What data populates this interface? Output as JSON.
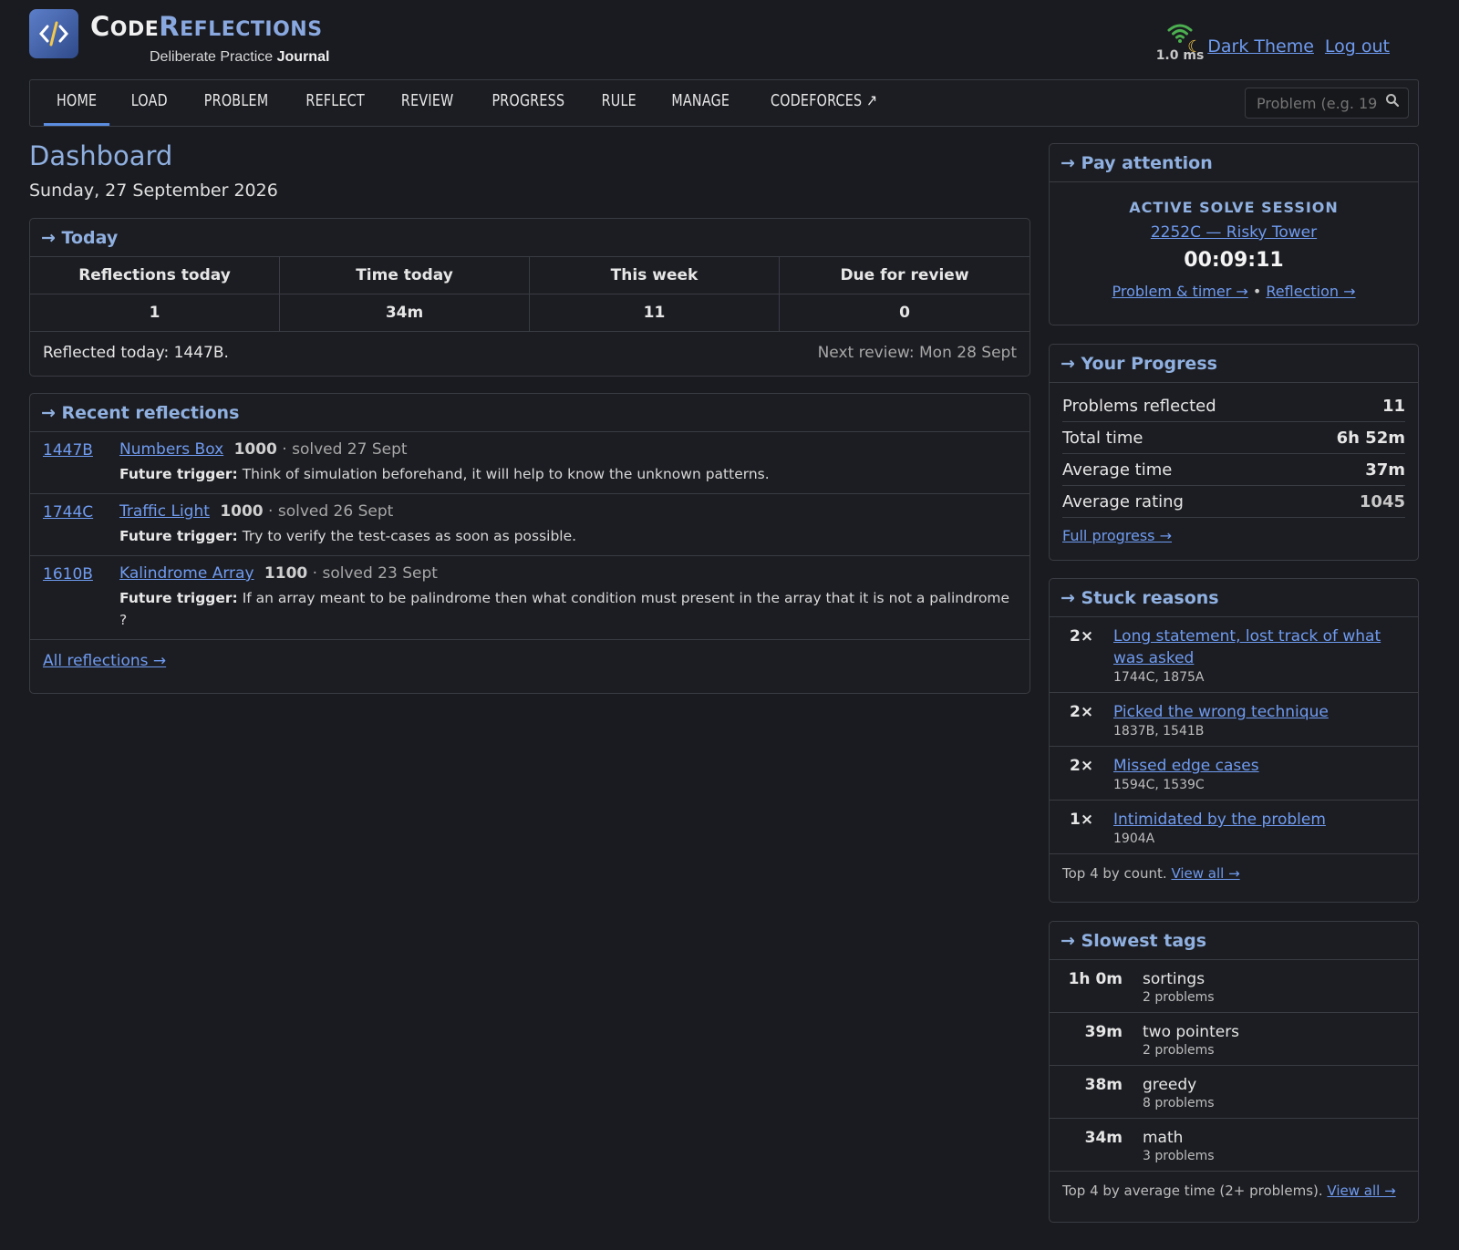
{
  "header": {
    "brand_main_1": "C",
    "brand_small_1": "ODE",
    "brand_main_2": "R",
    "brand_small_2": "EFLECTIONS",
    "tagline_prefix": "Deliberate Practice",
    "tagline_bold": "Journal",
    "latency": "1.0 ms",
    "theme_label": "Dark Theme",
    "logout_label": "Log out"
  },
  "nav": {
    "items": [
      "HOME",
      "LOAD",
      "PROBLEM",
      "REFLECT",
      "REVIEW",
      "PROGRESS",
      "RULE",
      "MANAGE",
      "CODEFORCES ↗"
    ],
    "active": "HOME",
    "search_placeholder": "Problem (e.g. 19"
  },
  "page": {
    "title": "Dashboard",
    "date": "Sunday, 27 September 2026"
  },
  "today": {
    "heading": "→ Today",
    "stats": [
      {
        "label": "Reflections today",
        "value": "1"
      },
      {
        "label": "Time today",
        "value": "34m"
      },
      {
        "label": "This week",
        "value": "11"
      },
      {
        "label": "Due for review",
        "value": "0"
      }
    ],
    "reflected": "Reflected today: 1447B.",
    "next_review": "Next review: Mon 28 Sept"
  },
  "recent": {
    "heading": "→ Recent reflections",
    "trigger_label": "Future trigger:",
    "items": [
      {
        "id": "1447B",
        "name": "Numbers Box",
        "rating": "1000",
        "solved": "· solved 27 Sept",
        "trigger": "Think of simulation beforehand, it will help to know the unknown patterns."
      },
      {
        "id": "1744C",
        "name": "Traffic Light",
        "rating": "1000",
        "solved": "· solved 26 Sept",
        "trigger": "Try to verify the test-cases as soon as possible."
      },
      {
        "id": "1610B",
        "name": "Kalindrome Array",
        "rating": "1100",
        "solved": "· solved 23 Sept",
        "trigger": "If an array meant to be palindrome then what condition must present in the array that it is not a palindrome ?"
      }
    ],
    "all_link": "All reflections →"
  },
  "attention": {
    "heading": "→ Pay attention",
    "label": "ACTIVE SOLVE SESSION",
    "problem": "2252C — Risky Tower",
    "timer": "00:09:11",
    "link1": "Problem & timer →",
    "sep": "•",
    "link2": "Reflection →"
  },
  "progress": {
    "heading": "→ Your Progress",
    "rows": [
      {
        "label": "Problems reflected",
        "value": "11"
      },
      {
        "label": "Total time",
        "value": "6h 52m"
      },
      {
        "label": "Average time",
        "value": "37m"
      },
      {
        "label": "Average rating",
        "value": "1045"
      }
    ],
    "link": "Full progress →"
  },
  "stuck": {
    "heading": "→ Stuck reasons",
    "rows": [
      {
        "count": "2×",
        "reason": "Long statement, lost track of what was asked",
        "ids": "1744C, 1875A"
      },
      {
        "count": "2×",
        "reason": "Picked the wrong technique",
        "ids": "1837B, 1541B"
      },
      {
        "count": "2×",
        "reason": "Missed edge cases",
        "ids": "1594C, 1539C"
      },
      {
        "count": "1×",
        "reason": "Intimidated by the problem",
        "ids": "1904A"
      }
    ],
    "footer": "Top 4 by count.",
    "view_all": "View all →"
  },
  "slowest": {
    "heading": "→ Slowest tags",
    "rows": [
      {
        "time": "1h 0m",
        "tag": "sortings",
        "count": "2 problems"
      },
      {
        "time": "39m",
        "tag": "two pointers",
        "count": "2 problems"
      },
      {
        "time": "38m",
        "tag": "greedy",
        "count": "8 problems"
      },
      {
        "time": "34m",
        "tag": "math",
        "count": "3 problems"
      }
    ],
    "footer": "Top 4 by average time (2+ problems).",
    "view_all": "View all →"
  },
  "colors": {
    "background": "#1a1b20",
    "accent": "#8fb0e0",
    "link": "#6f9bf0",
    "wifi": "#4caf50",
    "moon": "#f3c84b"
  }
}
